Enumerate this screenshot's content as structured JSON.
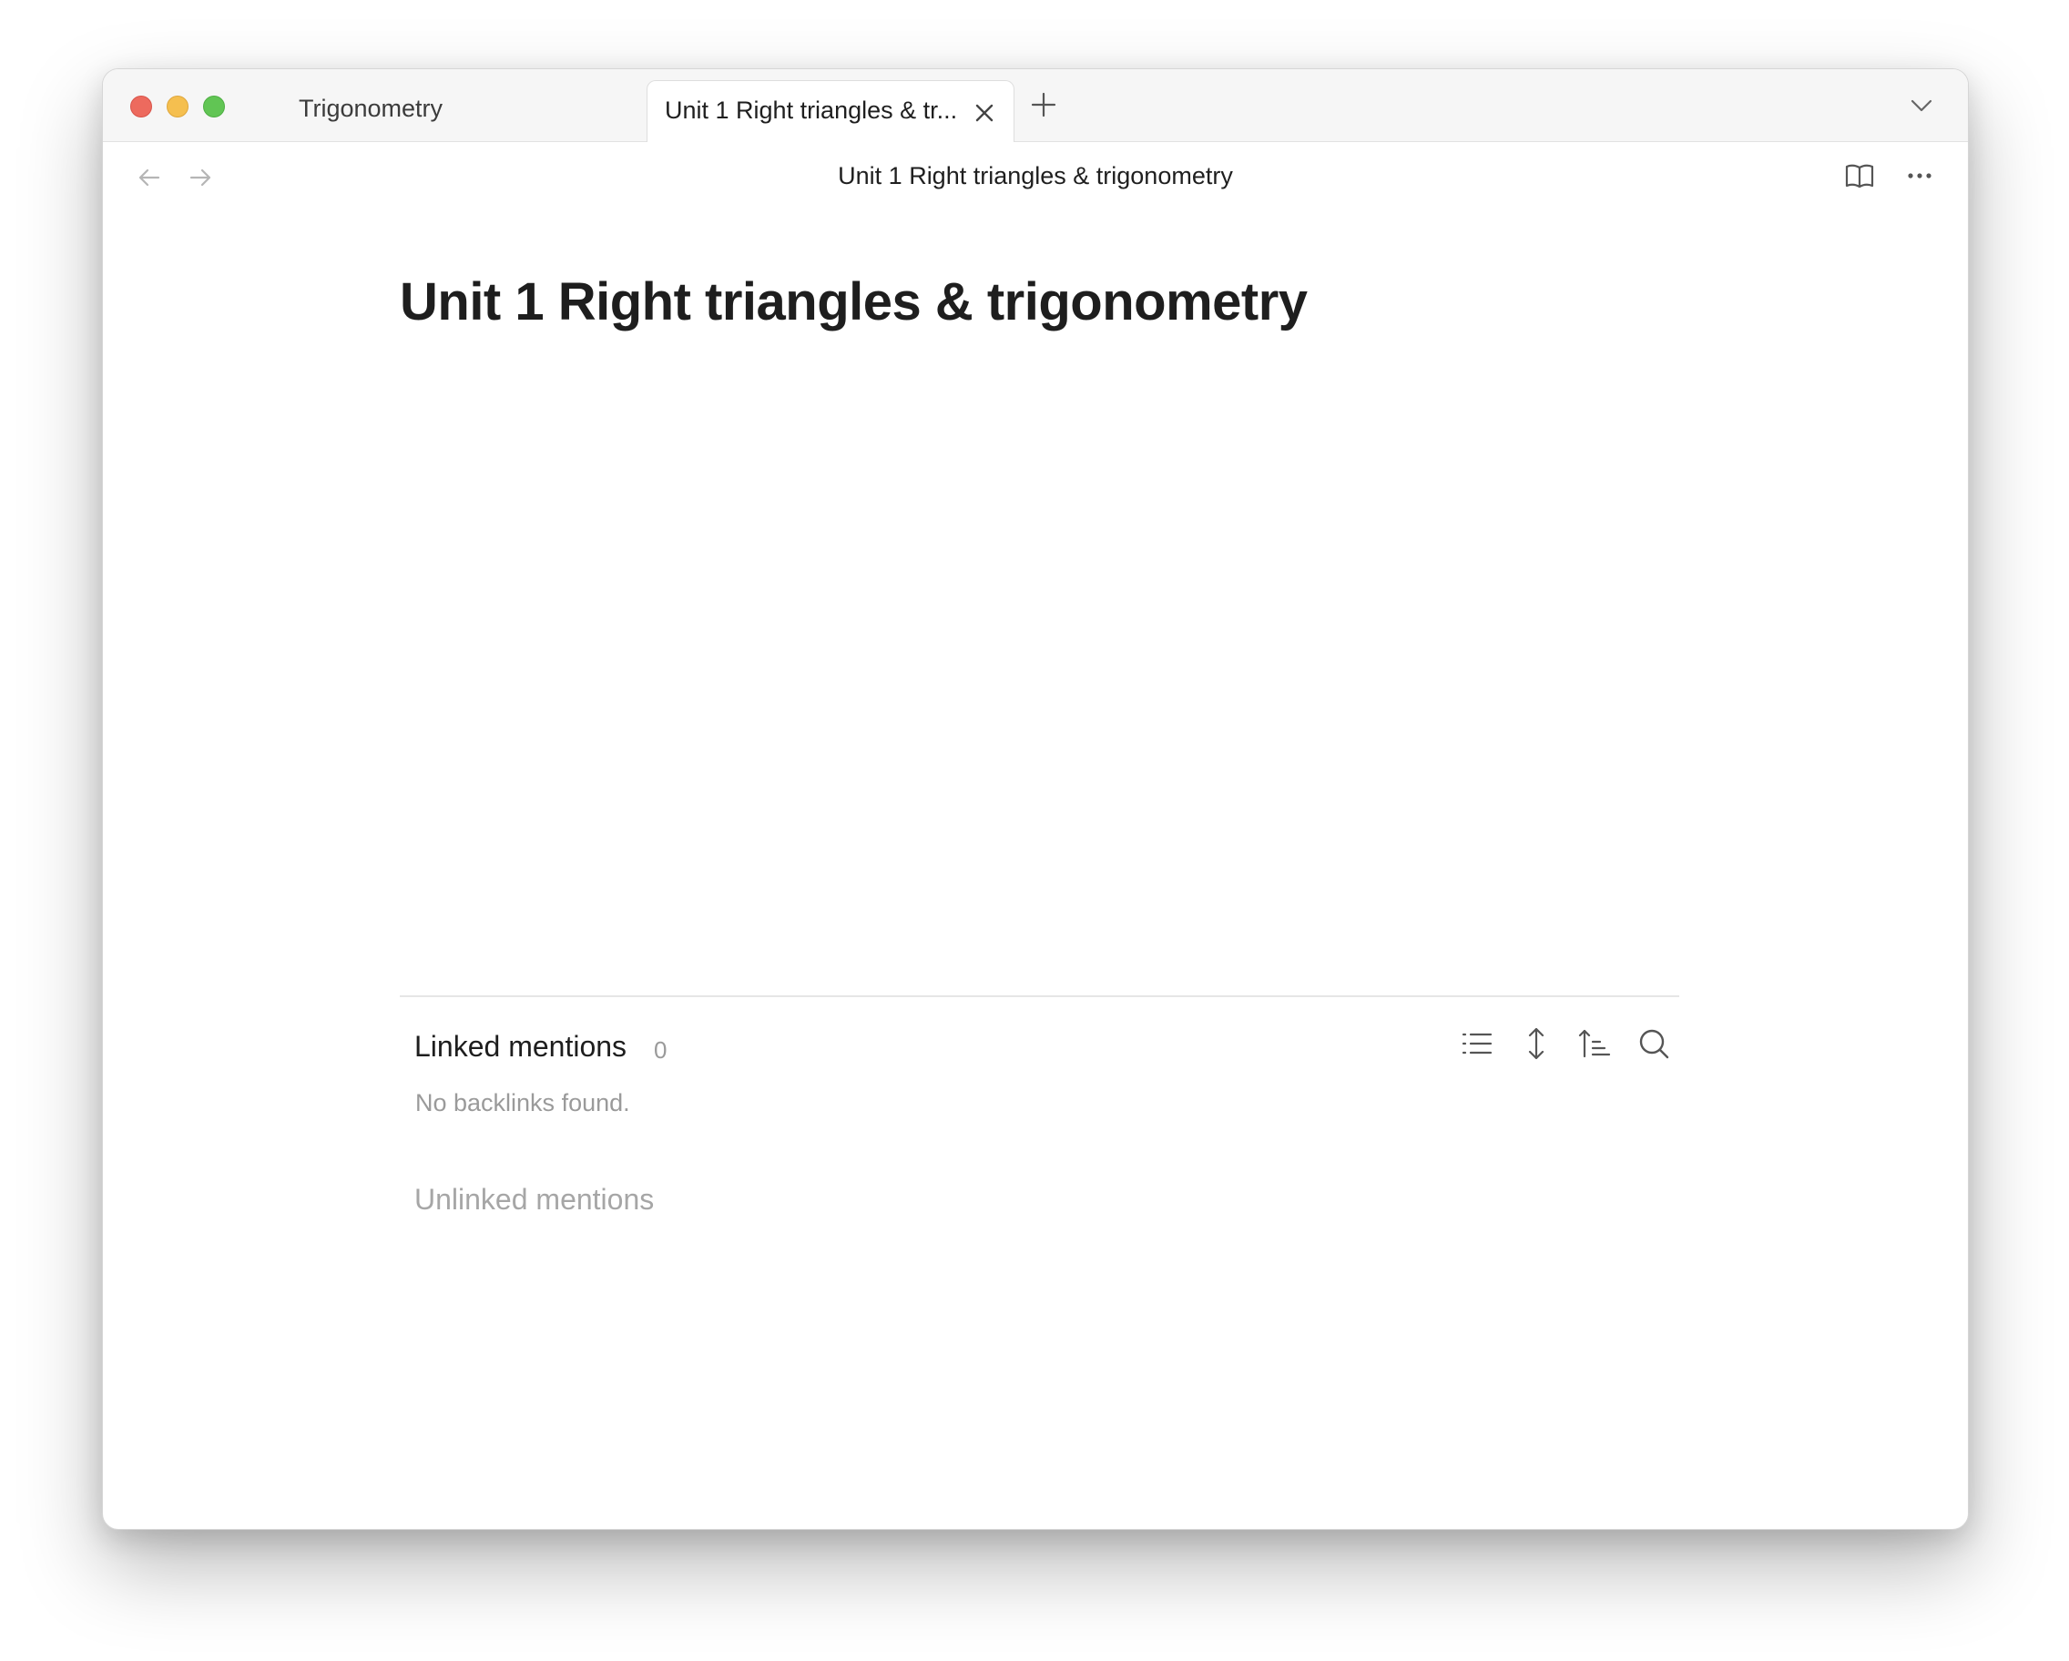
{
  "window": {
    "tabs": [
      {
        "label": "Trigonometry",
        "active": false
      },
      {
        "label": "Unit 1 Right triangles & tr...",
        "active": true
      }
    ]
  },
  "nav": {
    "title": "Unit 1 Right triangles & trigonometry"
  },
  "page": {
    "title": "Unit 1 Right triangles & trigonometry"
  },
  "backlinks": {
    "linked_heading": "Linked mentions",
    "linked_count": "0",
    "empty_message": "No backlinks found.",
    "unlinked_heading": "Unlinked mentions"
  },
  "icons": {
    "close": "close-icon",
    "new_tab": "plus-icon",
    "tab_list": "chevron-down-icon",
    "back": "arrow-left-icon",
    "forward": "arrow-right-icon",
    "reading_view": "book-open-icon",
    "more": "more-options-icon",
    "collapse_results": "list-icon",
    "expand_context": "expand-vertical-icon",
    "sort": "sort-icon",
    "search": "search-icon"
  },
  "colors": {
    "traffic_close": "#ed6a5e",
    "traffic_minimize": "#f5bf4f",
    "traffic_maximize": "#61c554"
  }
}
